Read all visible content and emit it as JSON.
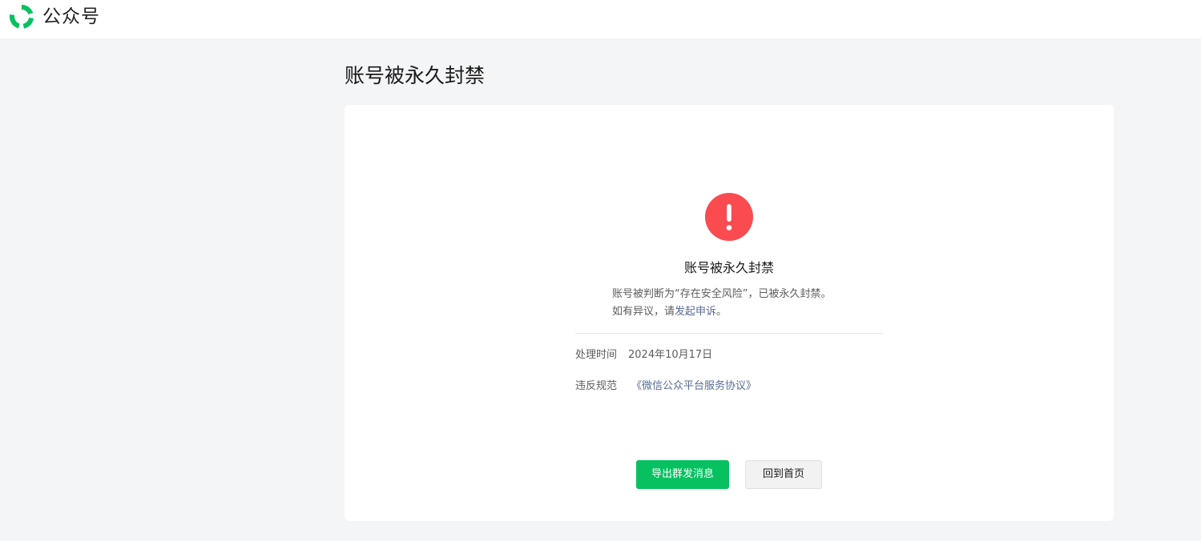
{
  "header": {
    "brand_text": "公众号"
  },
  "page": {
    "title": "账号被永久封禁"
  },
  "notice": {
    "icon": "exclamation-circle-icon",
    "icon_color": "#fa4b50",
    "title": "账号被永久封禁",
    "line1": "账号被判断为“存在安全风险”，已被永久封禁。",
    "line2_prefix": "如有异议，请",
    "appeal_link": "发起申诉",
    "line2_suffix": "。"
  },
  "details": {
    "time_label": "处理时间",
    "time_value": "2024年10月17日",
    "rule_label": "违反规范",
    "rule_link": "《微信公众平台服务协议》"
  },
  "actions": {
    "export_label": "导出群发消息",
    "home_label": "回到首页"
  },
  "colors": {
    "accent_green": "#07c160",
    "link_blue": "#576b95",
    "warning_red": "#fa4b50",
    "page_background": "#f4f5f7"
  }
}
